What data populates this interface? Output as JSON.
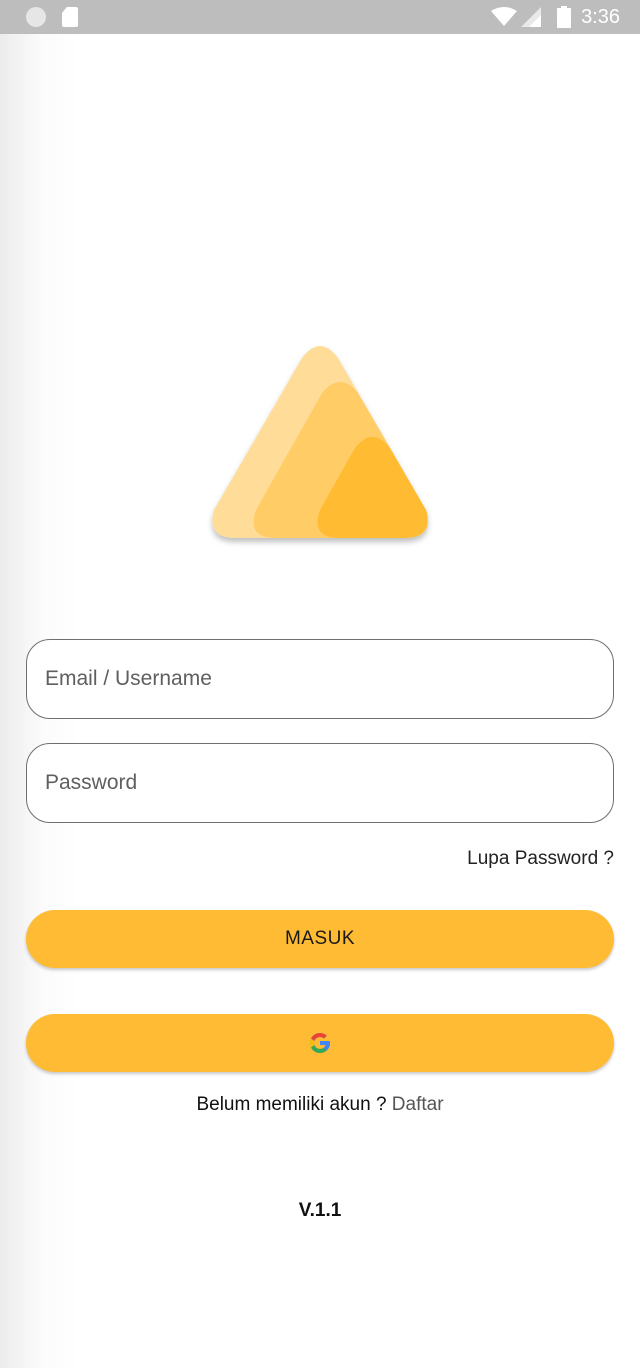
{
  "status_bar": {
    "time": "3:36",
    "icons": [
      "circle-indicator-icon",
      "sd-card-icon",
      "wifi-icon",
      "signal-icon",
      "battery-icon"
    ]
  },
  "logo": {
    "icon": "triangle-logo-icon",
    "colors": [
      "#ffdd99",
      "#ffcc66",
      "#ffbb33"
    ]
  },
  "form": {
    "email_placeholder": "Email / Username",
    "password_placeholder": "Password",
    "forgot_label": "Lupa Password ?",
    "login_label": "MASUK",
    "google_icon": "google-icon"
  },
  "signup": {
    "prompt": "Belum memiliki akun ? ",
    "link": "Daftar"
  },
  "version": "V.1.1",
  "colors": {
    "accent": "#ffbb33",
    "status_bar": "#bdbdbd"
  }
}
